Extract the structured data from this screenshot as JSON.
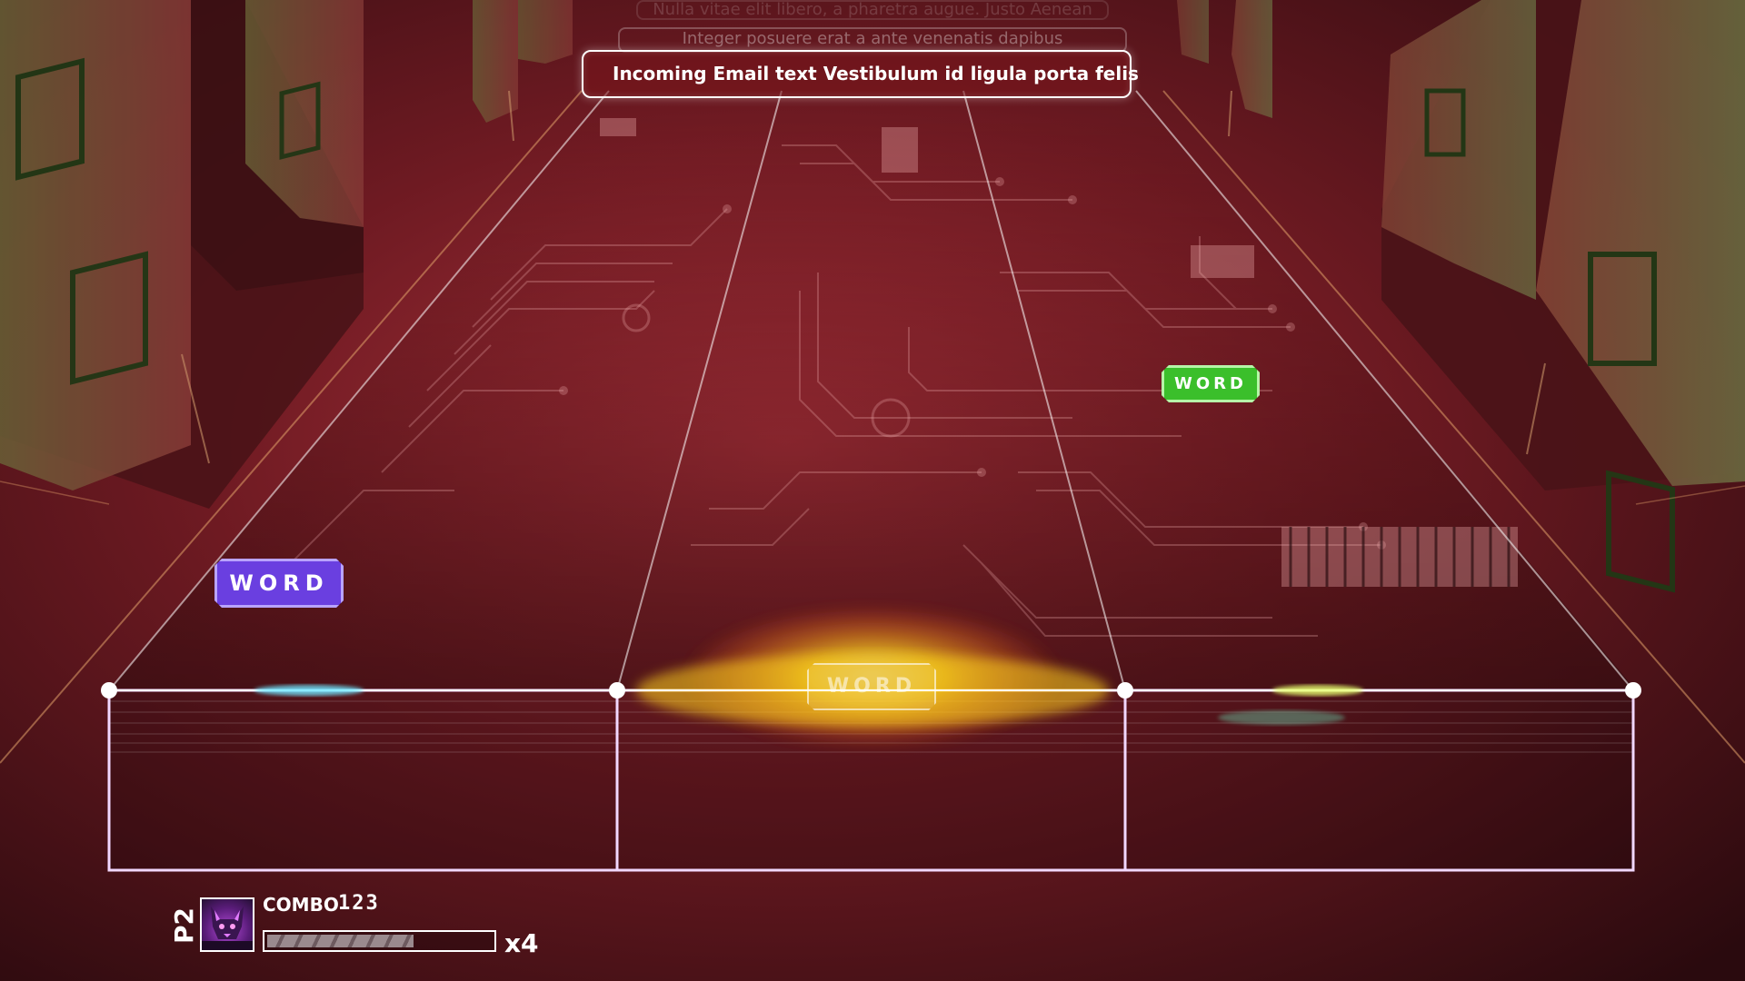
{
  "email": {
    "ghost_lines": [
      "Nulla vitae elit libero, a pharetra augue. Justo Aenean",
      "Integer posuere erat a ante venenatis dapibus"
    ],
    "main_text": "Incoming Email text Vestibulum id ligula porta felis"
  },
  "notes": {
    "purple": "WORD",
    "green": "WORD",
    "center": "WORD"
  },
  "hud": {
    "player": "P2",
    "combo_label": "COMBO",
    "combo_value": "123",
    "progress": 0.65,
    "multiplier": "x4"
  },
  "colors": {
    "background": "#3a0f14",
    "lane_line": "#ffffff",
    "note_purple": "#6a3fe0",
    "note_green": "#3bbf2b",
    "hit_glow": "#ffd21f"
  }
}
